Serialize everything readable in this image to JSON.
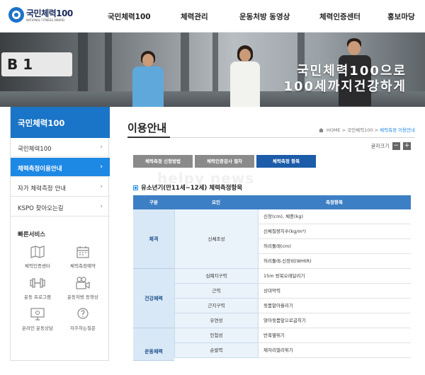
{
  "header": {
    "logo_text": "국민체력100",
    "logo_sub": "NATIONAL FITNESS AWARD",
    "nav": [
      "국민체력100",
      "체력관리",
      "운동처방 동영상",
      "체력인증센터",
      "홍보마당"
    ]
  },
  "banner": {
    "sign_text": "B 1",
    "slogan_line1": "국민체력100으로",
    "slogan_line2": "100세까지건강하게"
  },
  "sidebar": {
    "title": "국민체력100",
    "items": [
      {
        "label": "국민체력100",
        "active": false
      },
      {
        "label": "체력측정이용안내",
        "active": true
      },
      {
        "label": "자가 체력측정 안내",
        "active": false
      },
      {
        "label": "KSPO 찾아오는길",
        "active": false
      }
    ],
    "quick_title": "빠른서비스",
    "quick_services": [
      {
        "label": "체력인증센터",
        "icon": "map-icon"
      },
      {
        "label": "체력측정예약",
        "icon": "calendar-icon"
      },
      {
        "label": "운동 프로그램",
        "icon": "dumbbell-icon"
      },
      {
        "label": "운동처방 동영상",
        "icon": "video-camera-icon"
      },
      {
        "label": "온라인 운동상담",
        "icon": "monitor-chat-icon"
      },
      {
        "label": "자주하는질문",
        "icon": "question-bubble-icon"
      }
    ]
  },
  "content": {
    "page_title": "이용안내",
    "breadcrumb": [
      "HOME",
      "국민체력100",
      "체력측정 이용안내"
    ],
    "font_size_label": "글자크기",
    "font_minus": "−",
    "font_plus": "+",
    "tabs": [
      {
        "label": "체력측정 신청방법",
        "active": false
      },
      {
        "label": "체력인증검사 절차",
        "active": false
      },
      {
        "label": "체력측정 항목",
        "active": true
      }
    ],
    "watermark": "helpy news",
    "section_title": "유소년기(만11세~12세) 체력측정항목",
    "table": {
      "headers": [
        "구분",
        "요인",
        "측정항목"
      ],
      "groups": [
        {
          "name": "체격",
          "factors": [
            {
              "name": "신체조성",
              "items": [
                "신장(cm), 체중(kg)",
                "신체질량지수(kg/m²)",
                "허리둘레(cm)",
                "허리둘레-신장비(WHtR)"
              ]
            }
          ]
        },
        {
          "name": "건강체력",
          "factors": [
            {
              "name": "심폐지구력",
              "items": [
                "15m 왕복오래달리기"
              ]
            },
            {
              "name": "근력",
              "items": [
                "상대악력"
              ]
            },
            {
              "name": "근지구력",
              "items": [
                "윗몸말아올리기"
              ]
            },
            {
              "name": "유연성",
              "items": [
                "앉아윗몸앞으로굽히기"
              ]
            }
          ]
        },
        {
          "name": "운동체력",
          "factors": [
            {
              "name": "민첩성",
              "items": [
                "반복옆뛰기"
              ]
            },
            {
              "name": "순발력",
              "items": [
                "제자리멀리뛰기"
              ]
            }
          ]
        }
      ]
    }
  },
  "colors": {
    "brand_blue": "#1a74c7",
    "active_blue": "#1e88e5",
    "tab_active": "#1c5ca8",
    "table_header": "#3d7fc4"
  }
}
